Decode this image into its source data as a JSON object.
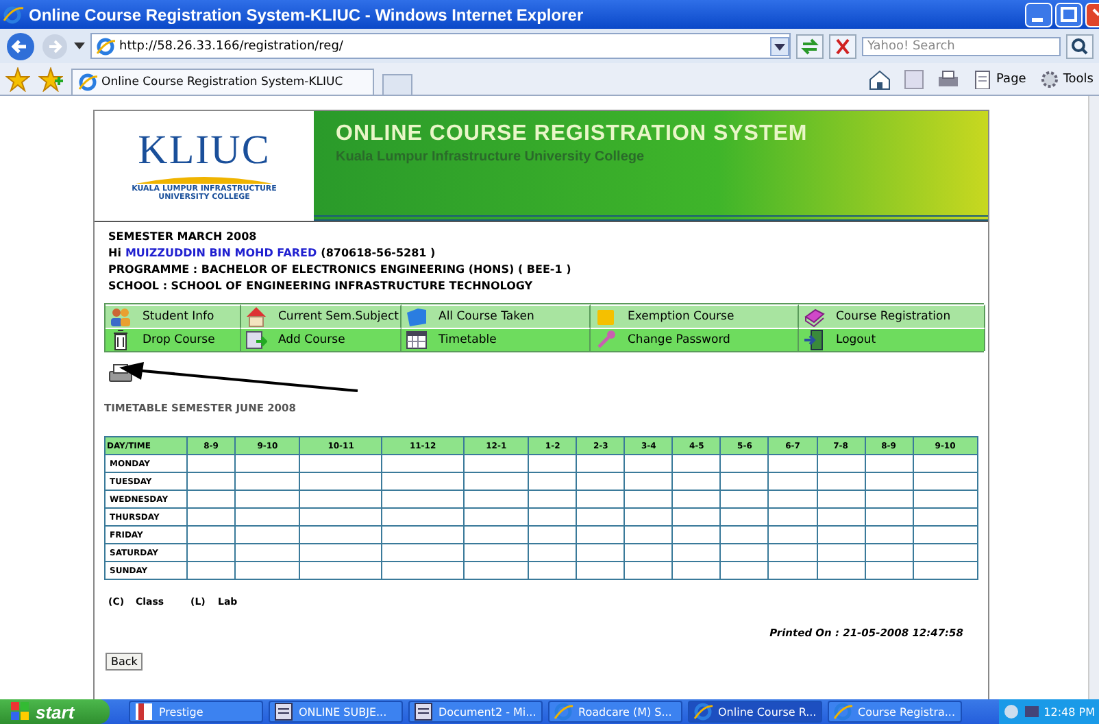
{
  "window": {
    "title": "Online Course Registration System-KLIUC - Windows Internet Explorer"
  },
  "address_bar": {
    "url": "http://58.26.33.166/registration/reg/",
    "search_placeholder": "Yahoo! Search"
  },
  "tab": {
    "label": "Online Course Registration System-KLIUC"
  },
  "command_bar": [
    "Page",
    "Tools"
  ],
  "header": {
    "logo": "KLIUC",
    "logo_subtitle": "KUALA LUMPUR INFRASTRUCTURE UNIVERSITY COLLEGE",
    "title": "ONLINE COURSE REGISTRATION SYSTEM",
    "subtitle": "Kuala Lumpur Infrastructure University College"
  },
  "info": {
    "semester": "SEMESTER MARCH 2008",
    "greeting": "Hi",
    "name": "MUIZZUDDIN BIN MOHD FARED",
    "student_id": "(870618-56-5281 )",
    "programme": "PROGRAMME : BACHELOR OF ELECTRONICS ENGINEERING (HONS) ( BEE-1 )",
    "school": "SCHOOL : SCHOOL OF ENGINEERING INFRASTRUCTURE TECHNOLOGY"
  },
  "menu": [
    [
      {
        "label": "Student Info"
      },
      {
        "label": "Current Sem.Subject"
      },
      {
        "label": "All Course Taken"
      },
      {
        "label": "Exemption Course"
      },
      {
        "label": "Course Registration"
      }
    ],
    [
      {
        "label": "Drop Course"
      },
      {
        "label": "Add Course"
      },
      {
        "label": "Timetable"
      },
      {
        "label": "Change Password"
      },
      {
        "label": "Logout"
      }
    ]
  ],
  "timetable": {
    "title": "TIMETABLE SEMESTER JUNE 2008",
    "columns": [
      "DAY/TIME",
      "8-9",
      "9-10",
      "10-11",
      "11-12",
      "12-1",
      "1-2",
      "2-3",
      "3-4",
      "4-5",
      "5-6",
      "6-7",
      "7-8",
      "8-9",
      "9-10"
    ],
    "rows": [
      "MONDAY",
      "TUESDAY",
      "WEDNESDAY",
      "THURSDAY",
      "FRIDAY",
      "SATURDAY",
      "SUNDAY"
    ]
  },
  "legend": [
    "(C)",
    "Class",
    "(L)",
    "Lab"
  ],
  "printed_on": "Printed On : 21-05-2008  12:47:58",
  "back_button": "Back",
  "taskbar": {
    "start": "start",
    "items": [
      {
        "label": "Prestige",
        "selected": false
      },
      {
        "label": "ONLINE SUBJE...",
        "selected": false
      },
      {
        "label": "Document2 - Mi...",
        "selected": false
      },
      {
        "label": "Roadcare (M) S...",
        "selected": false
      },
      {
        "label": "Online Course R...",
        "selected": true
      },
      {
        "label": "Course Registra...",
        "selected": false
      }
    ],
    "clock": "12:48 PM"
  }
}
